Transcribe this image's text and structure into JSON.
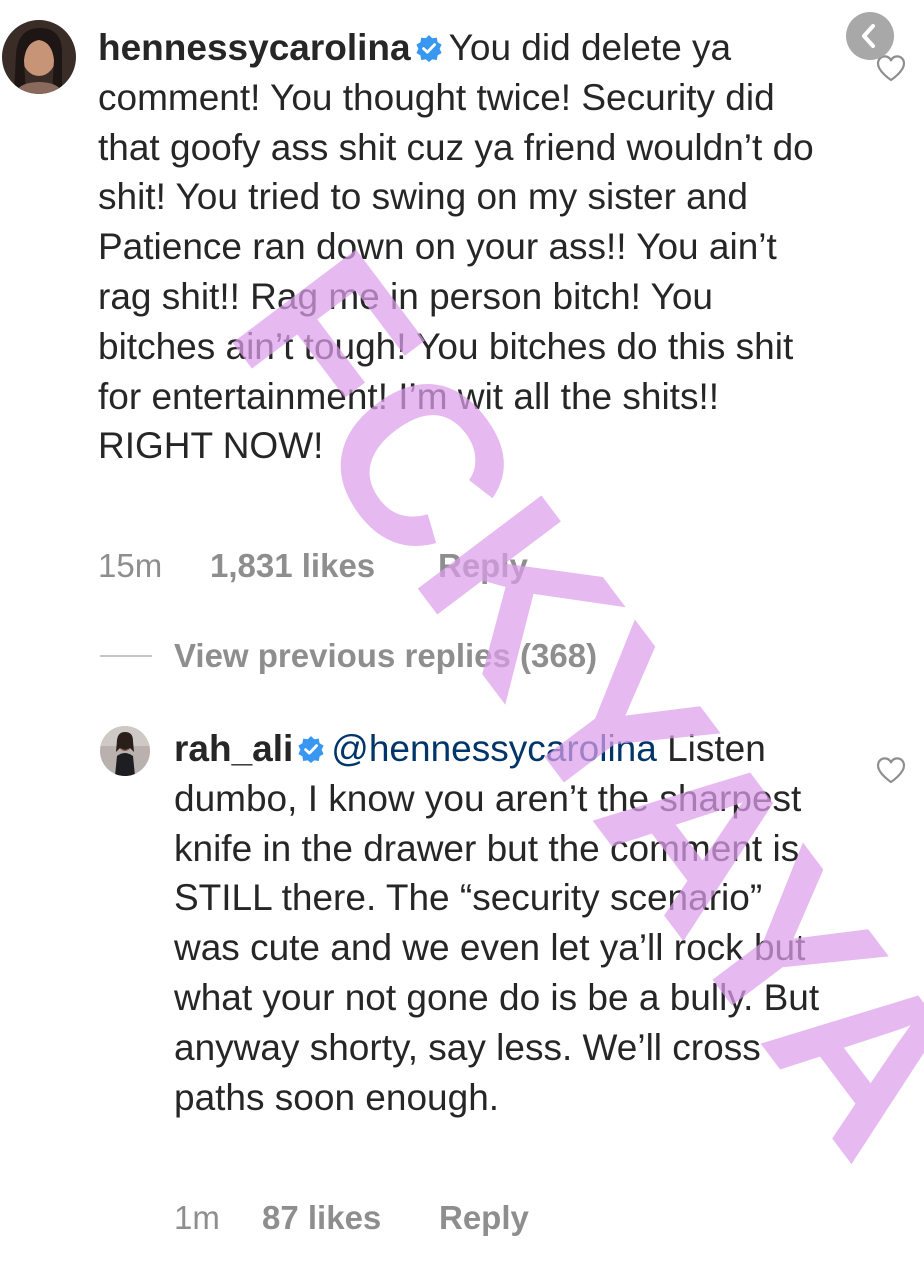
{
  "comments": [
    {
      "username": "hennessycarolina",
      "verified": true,
      "mention": "",
      "text": "You did delete ya comment! You thought twice! Security did that goofy ass shit cuz ya friend wouldn’t do shit! You tried to swing on my sister and Patience ran down on your ass!! You ain’t rag shit!! Rag me in person bitch! You bitches ain’t tough! You bitches do this shit for entertainment! I’m wit all the shits!! RIGHT NOW!",
      "time": "15m",
      "likes": "1,831 likes",
      "reply": "Reply"
    },
    {
      "username": "rah_ali",
      "verified": true,
      "mention": "@hennessycarolina",
      "text": "Listen dumbo, I know you aren’t the sharpest knife in the drawer but the comment is STILL there. The “security scenario” was cute and we even let ya’ll rock but what your not gone do is be a bully. But anyway shorty, say less. We’ll cross paths soon enough.",
      "time": "1m",
      "likes": "87 likes",
      "reply": "Reply"
    }
  ],
  "view_replies": "View previous replies (368)",
  "watermark": "FCKYAYA",
  "icons": {
    "verified": "verified-badge-icon",
    "like": "heart-icon",
    "back": "chevron-left-icon"
  },
  "colors": {
    "text": "#262626",
    "meta": "#8e8e8e",
    "mention": "#003569",
    "verified": "#3897f0",
    "watermark": "#dda0ec"
  }
}
